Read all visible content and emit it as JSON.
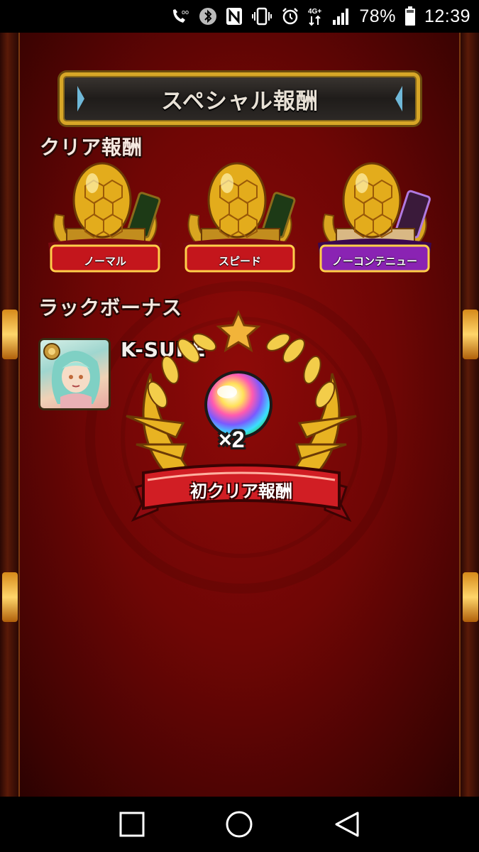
{
  "status_bar": {
    "battery_percent": "78%",
    "time": "12:39",
    "network_type": "4G+",
    "icons": [
      "wifi-calling-icon",
      "bluetooth-icon",
      "nfc-icon",
      "vibrate-icon",
      "alarm-icon",
      "network-4g-icon",
      "signal-icon",
      "battery-icon"
    ]
  },
  "screen": {
    "title": "スペシャル報酬",
    "clear_rewards": {
      "heading": "クリア報酬",
      "items": [
        {
          "label": "ノーマル",
          "ribbon_color": "#c4161c"
        },
        {
          "label": "スピード",
          "ribbon_color": "#c4161c"
        },
        {
          "label": "ノーコンテニュー",
          "ribbon_color": "#8a23b3"
        }
      ]
    },
    "luck_bonus": {
      "heading": "ラックボーナス",
      "player_name": "K-SUKE"
    },
    "first_clear_popup": {
      "count": "×2",
      "label": "初クリア報酬"
    }
  },
  "nav_bar": {
    "buttons": [
      "recent-apps-button",
      "home-button",
      "back-button"
    ]
  }
}
